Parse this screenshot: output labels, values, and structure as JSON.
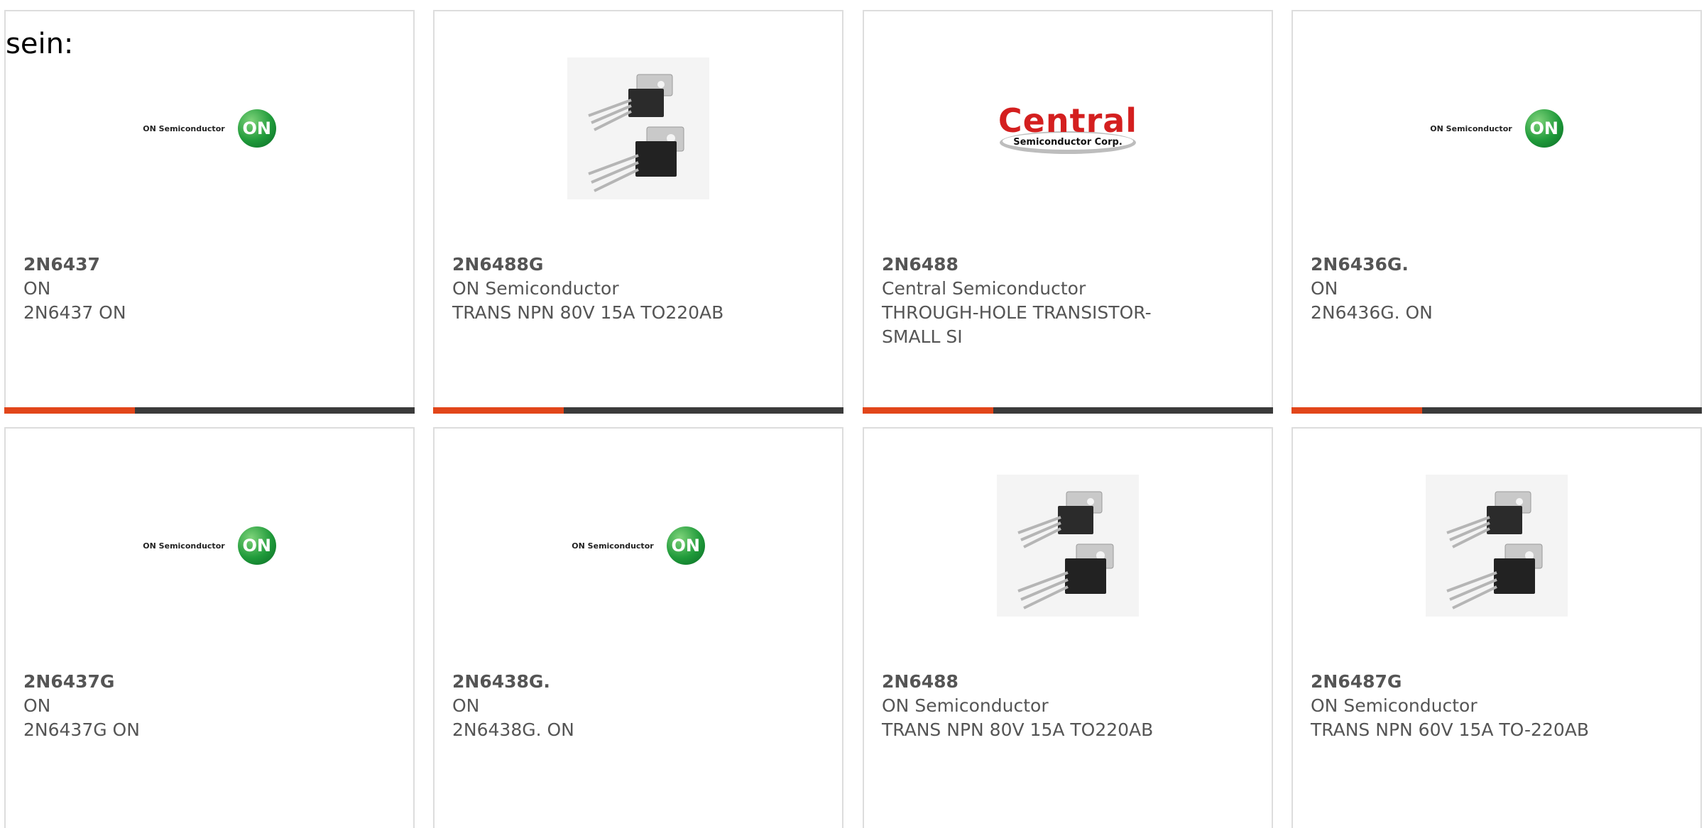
{
  "intro_text": "sein:",
  "colors": {
    "accent": "#e2461a",
    "bar": "#3b3b3b",
    "text": "#555555"
  },
  "logos": {
    "on_text": "ON Semiconductor",
    "on_badge": "ON",
    "central_word": "Central",
    "central_sub": "Semiconductor Corp."
  },
  "cards": [
    {
      "part": "2N6437",
      "maker": "ON",
      "desc": "2N6437 ON",
      "image": "on-semiconductor-logo"
    },
    {
      "part": "2N6488G",
      "maker": "ON Semiconductor",
      "desc": "TRANS NPN 80V 15A TO220AB",
      "image": "to220-transistor-photo"
    },
    {
      "part": "2N6488",
      "maker": "Central Semiconductor",
      "desc": "THROUGH-HOLE TRANSISTOR-SMALL SI",
      "image": "central-semiconductor-logo"
    },
    {
      "part": "2N6436G.",
      "maker": "ON",
      "desc": "2N6436G. ON",
      "image": "on-semiconductor-logo"
    },
    {
      "part": "2N6437G",
      "maker": "ON",
      "desc": "2N6437G ON",
      "image": "on-semiconductor-logo"
    },
    {
      "part": "2N6438G.",
      "maker": "ON",
      "desc": "2N6438G. ON",
      "image": "on-semiconductor-logo"
    },
    {
      "part": "2N6488",
      "maker": "ON Semiconductor",
      "desc": "TRANS NPN 80V 15A TO220AB",
      "image": "to220-transistor-photo"
    },
    {
      "part": "2N6487G",
      "maker": "ON Semiconductor",
      "desc": "TRANS NPN 60V 15A TO-220AB",
      "image": "to220-transistor-photo"
    }
  ]
}
